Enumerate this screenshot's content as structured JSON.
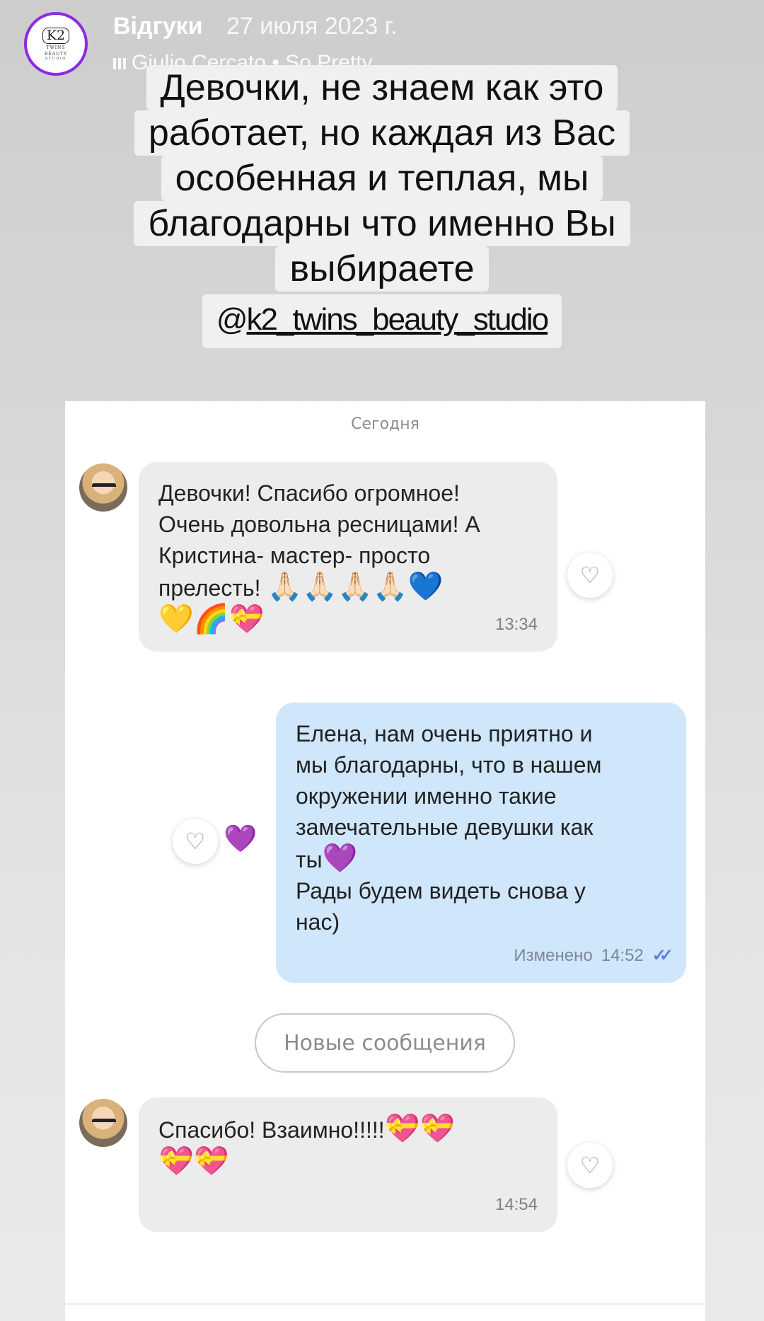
{
  "story": {
    "title": "Відгуки",
    "date": "27 июля 2023 г.",
    "music": "Giulio Cercato • So Pretty",
    "logo": {
      "main": "K2",
      "line1": "twins",
      "line2": "Beauty",
      "line3": "Studio"
    }
  },
  "caption": {
    "lines": [
      "Девочки, не знаем как это",
      "работает, но каждая из Вас",
      "особенная и теплая, мы",
      "благодарны что именно Вы",
      "выбираете"
    ],
    "mention_at": "@",
    "mention_handle": "k2_twins_beauty_studio"
  },
  "chat": {
    "day_label": "Сегодня",
    "messages": [
      {
        "direction": "in",
        "lines": [
          "Девочки! Спасибо огромное!",
          "Очень довольна ресницами! А",
          "Кристина- мастер- просто",
          "прелесть!"
        ],
        "emojis_line4": "🙏🏻🙏🏻🙏🏻🙏🏻💙",
        "emojis_line5": "💛🌈💝",
        "time": "13:34"
      },
      {
        "direction": "out",
        "lines": [
          "Елена, нам очень приятно и",
          "мы благодарны, что в нашем",
          "окружении именно такие",
          "замечательные девушки как",
          "ты",
          "Рады будем видеть снова у",
          "нас)"
        ],
        "emoji_after_ty": "💜",
        "edited_label": "Изменено",
        "time": "14:52",
        "reaction": "💜"
      },
      {
        "direction": "in",
        "line1": "Спасибо! Взаимно!!!!!",
        "emojis_line1": "💝💝",
        "emojis_line2": "💝💝",
        "time": "14:54"
      }
    ],
    "new_messages_label": "Новые сообщения"
  },
  "icons": {
    "heart_outline": "♡",
    "double_check": "✓✓"
  },
  "colors": {
    "avatar_ring": "#8a2be2",
    "incoming_bubble": "#ececec",
    "outgoing_bubble": "#cfe6fb",
    "check_blue": "#5b7fe0"
  }
}
